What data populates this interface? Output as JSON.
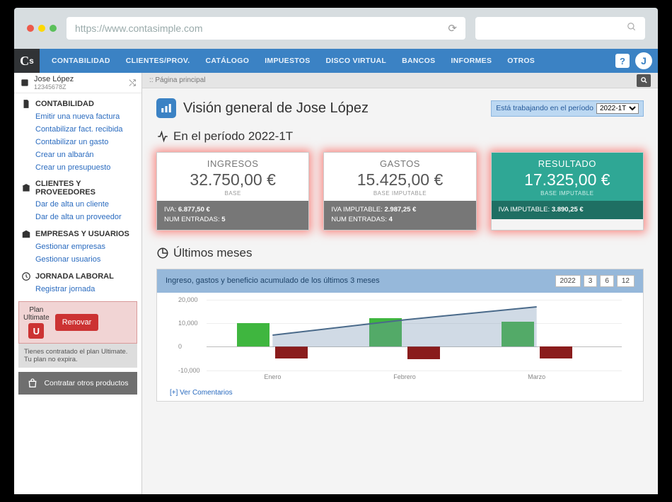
{
  "browser": {
    "url": "https://www.contasimple.com"
  },
  "user": {
    "name": "Jose López",
    "id": "12345678Z",
    "avatar_initial": "J"
  },
  "nav": {
    "items": [
      "CONTABILIDAD",
      "CLIENTES/PROV.",
      "CATÁLOGO",
      "IMPUESTOS",
      "DISCO VIRTUAL",
      "BANCOS",
      "INFORMES",
      "OTROS"
    ]
  },
  "sidebar": {
    "sections": [
      {
        "title": "CONTABILIDAD",
        "links": [
          "Emitir una nueva factura",
          "Contabilizar fact. recibida",
          "Contabilizar un gasto",
          "Crear un albarán",
          "Crear un presupuesto"
        ]
      },
      {
        "title": "CLIENTES Y PROVEEDORES",
        "links": [
          "Dar de alta un cliente",
          "Dar de alta un proveedor"
        ]
      },
      {
        "title": "EMPRESAS Y USUARIOS",
        "links": [
          "Gestionar empresas",
          "Gestionar usuarios"
        ]
      },
      {
        "title": "JORNADA LABORAL",
        "links": [
          "Registrar jornada"
        ]
      }
    ],
    "plan": {
      "label_line1": "Plan",
      "label_line2": "Ultimate",
      "renew": "Renovar",
      "desc": "Tienes contratado el plan Ultimate. Tu plan no expira."
    },
    "other_products": "Contratar otros productos"
  },
  "breadcrumb": ":: Página principal",
  "page": {
    "title_prefix": "Visión general de ",
    "working_period_label": "Está trabajando en el período",
    "period_options": [
      "2022-1T"
    ],
    "period_selected": "2022-1T",
    "period_heading": "En el período 2022-1T",
    "months_heading": "Últimos meses",
    "comments_link": "[+] Ver Comentarios"
  },
  "cards": {
    "ingresos": {
      "title": "INGRESOS",
      "value": "32.750,00 €",
      "sub": "BASE",
      "iva_label": "IVA:",
      "iva": "6.877,50 €",
      "num_label": "NUM ENTRADAS:",
      "num": "5"
    },
    "gastos": {
      "title": "GASTOS",
      "value": "15.425,00 €",
      "sub": "BASE IMPUTABLE",
      "iva_label": "IVA IMPUTABLE:",
      "iva": "2.987,25 €",
      "num_label": "NUM ENTRADAS:",
      "num": "4"
    },
    "resultado": {
      "title": "RESULTADO",
      "value": "17.325,00 €",
      "sub": "BASE IMPUTABLE",
      "iva_label": "IVA IMPUTABLE:",
      "iva": "3.890,25 €"
    }
  },
  "chart": {
    "title": "Ingreso, gastos y beneficio acumulado de los últimos 3 meses",
    "buttons": [
      "2022",
      "3",
      "6",
      "12"
    ]
  },
  "chart_data": {
    "type": "bar",
    "categories": [
      "Enero",
      "Febrero",
      "Marzo"
    ],
    "series": [
      {
        "name": "Ingresos",
        "color": "#3fb63f",
        "values": [
          10000,
          12000,
          10500
        ]
      },
      {
        "name": "Gastos",
        "color": "#8a1c1c",
        "values": [
          -5000,
          -5500,
          -5000
        ]
      },
      {
        "name": "Beneficio acumulado",
        "type": "area",
        "color": "#6b89a5",
        "values": [
          5000,
          11500,
          17000
        ]
      }
    ],
    "ylabel": "",
    "xlabel": "",
    "ylim": [
      -10000,
      20000
    ],
    "yticks": [
      -10000,
      0,
      10000,
      20000
    ],
    "ytick_labels": [
      "-10,000",
      "0",
      "10,000",
      "20,000"
    ]
  }
}
